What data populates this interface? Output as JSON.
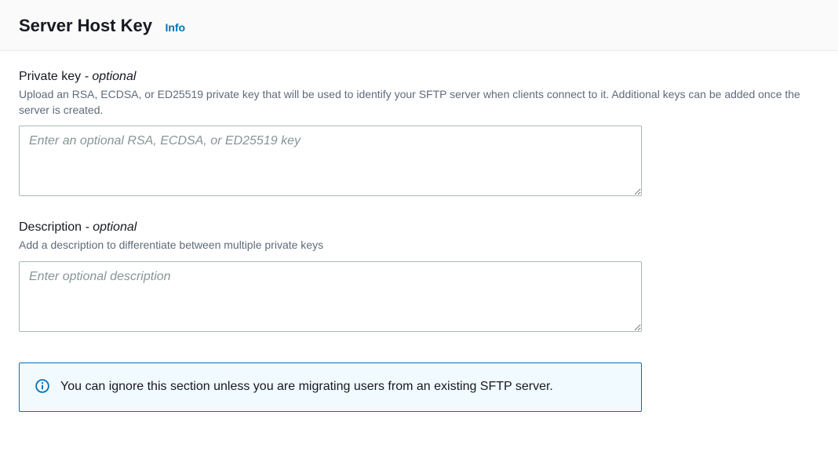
{
  "header": {
    "title": "Server Host Key",
    "info": "Info"
  },
  "privateKey": {
    "label": "Private key",
    "optional": " - optional",
    "help": "Upload an RSA, ECDSA, or ED25519 private key that will be used to identify your SFTP server when clients connect to it. Additional keys can be added once the server is created.",
    "placeholder": "Enter an optional RSA, ECDSA, or ED25519 key",
    "value": ""
  },
  "description": {
    "label": "Description",
    "optional": " - optional",
    "help": "Add a description to differentiate between multiple private keys",
    "placeholder": "Enter optional description",
    "value": ""
  },
  "infoBox": {
    "text": "You can ignore this section unless you are migrating users from an existing SFTP server."
  }
}
